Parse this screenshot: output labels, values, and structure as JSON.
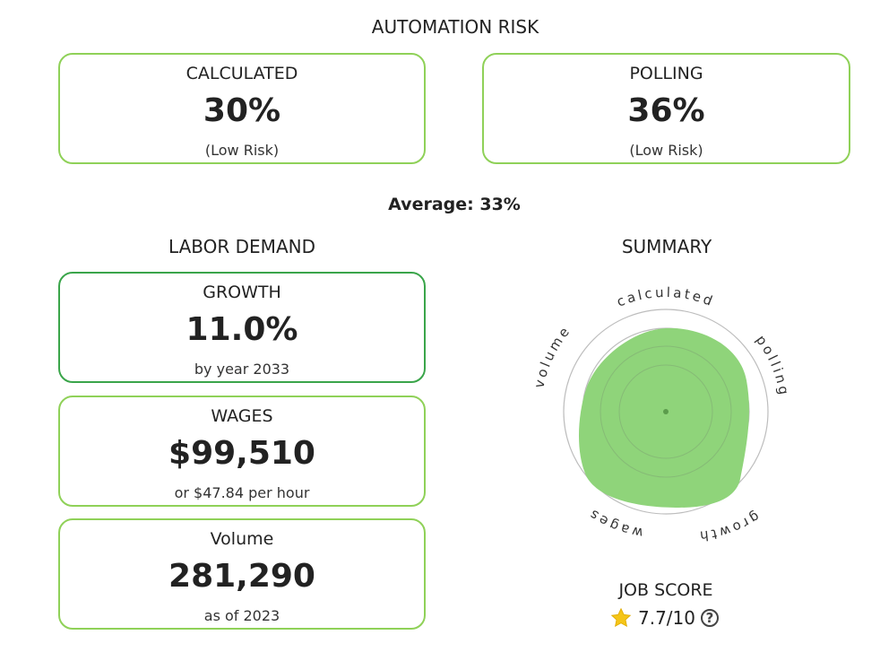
{
  "automation_risk": {
    "title": "AUTOMATION RISK",
    "calculated": {
      "label": "CALCULATED",
      "value": "30%",
      "note": "(Low Risk)"
    },
    "polling": {
      "label": "POLLING",
      "value": "36%",
      "note": "(Low Risk)"
    },
    "average": "Average: 33%"
  },
  "labor_demand": {
    "title": "LABOR DEMAND",
    "growth": {
      "label": "GROWTH",
      "value": "11.0%",
      "note": "by year 2033"
    },
    "wages": {
      "label": "WAGES",
      "value": "$99,510",
      "note": "or $47.84 per hour"
    },
    "volume": {
      "label": "Volume",
      "value": "281,290",
      "note": "as of 2023"
    }
  },
  "summary": {
    "title": "SUMMARY",
    "axes": [
      "calculated",
      "polling",
      "growth",
      "wages",
      "volume"
    ],
    "fill_color": "#8fd47a",
    "ring_color": "#bdbdbd"
  },
  "job_score": {
    "title": "JOB SCORE",
    "value": "7.7/10",
    "icons": [
      "star-icon",
      "help-icon"
    ],
    "star_color": "#f5c518"
  },
  "colors": {
    "card_border_light": "#8fd158",
    "card_border_dark": "#3aa54a"
  }
}
